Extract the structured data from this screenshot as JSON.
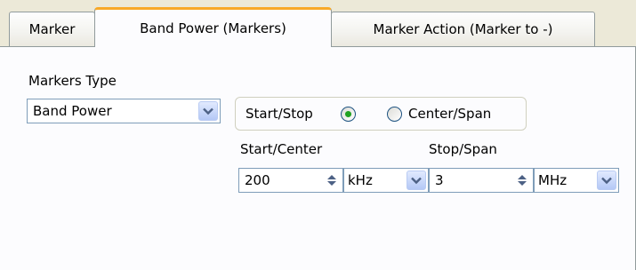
{
  "tabs": [
    {
      "label": "Marker"
    },
    {
      "label": "Band Power (Markers)"
    },
    {
      "label": "Marker Action (Marker to -)"
    }
  ],
  "markers_type": {
    "label": "Markers Type",
    "value": "Band Power"
  },
  "mode": {
    "option1": "Start/Stop",
    "option2": "Center/Span",
    "selected": "Start/Stop"
  },
  "start_center": {
    "label": "Start/Center",
    "value": "200",
    "unit": "kHz"
  },
  "stop_span": {
    "label": "Stop/Span",
    "value": "3",
    "unit": "MHz"
  },
  "colors": {
    "active_tab_accent": "#f8a928",
    "panel_bg": "#fcfcfe",
    "window_bg": "#ece9d8",
    "radio_selected": "#21a121"
  },
  "icons": [
    "chevron-down-icon",
    "spinner-icon",
    "radio-icon"
  ]
}
